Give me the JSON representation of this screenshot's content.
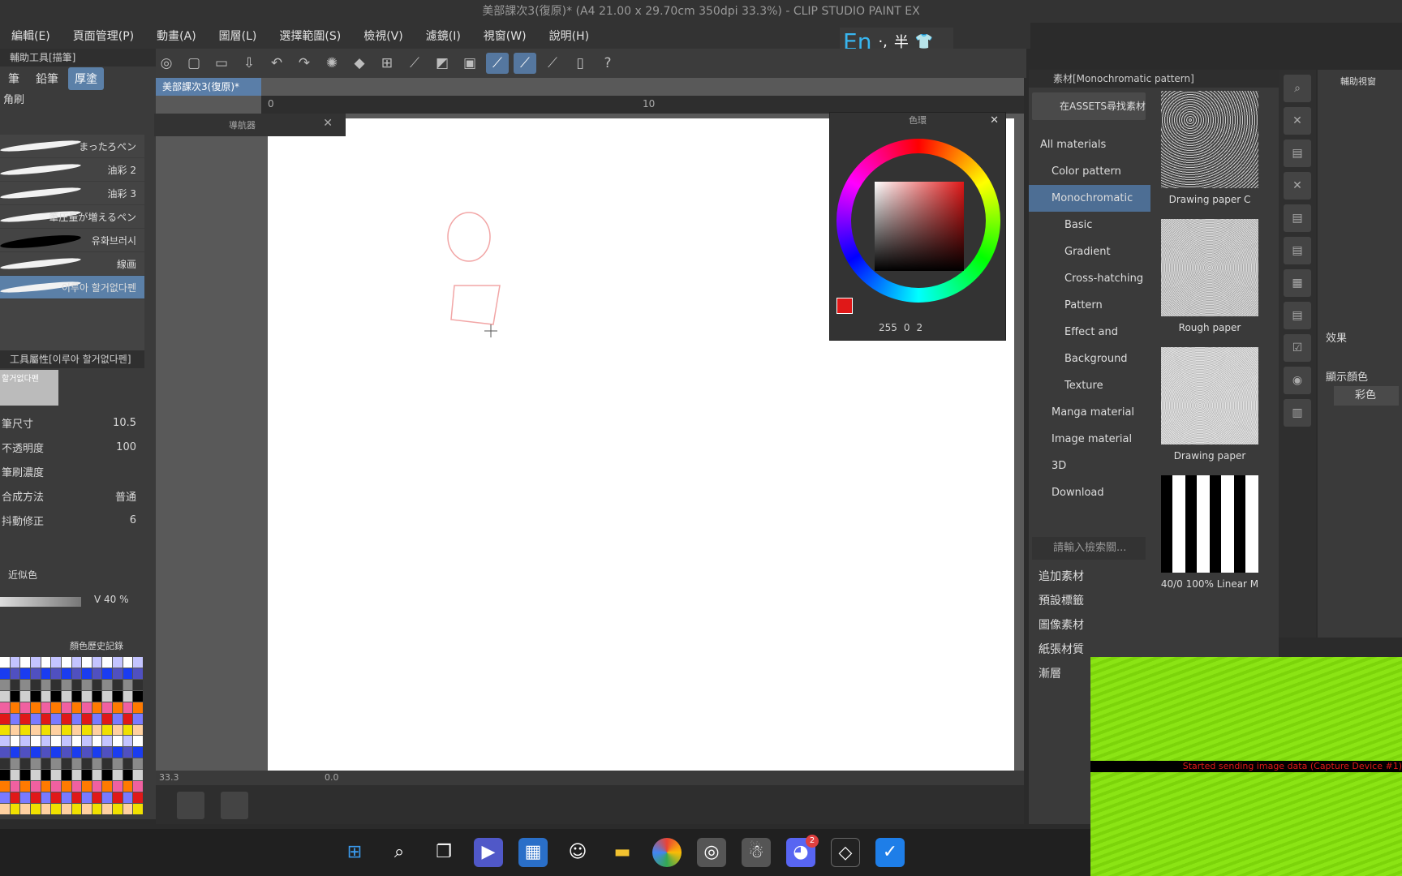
{
  "window": {
    "title": "美部課次3(復原)* (A4 21.00 x 29.70cm 350dpi 33.3%) - CLIP STUDIO PAINT EX"
  },
  "menu": [
    "編輯(E)",
    "頁面管理(P)",
    "動畫(A)",
    "圖層(L)",
    "選擇範圍(S)",
    "檢視(V)",
    "濾鏡(I)",
    "視窗(W)",
    "說明(H)"
  ],
  "ime": {
    "lang": "En",
    "punct": "·,",
    "width": "半",
    "skin_icon": "shirt-icon"
  },
  "doc_tab": {
    "label": "美部課次3(復原)*"
  },
  "ruler": {
    "mark0": "0",
    "mark10": "10"
  },
  "left_panel": {
    "header": "輔助工具[描筆]",
    "subtabs": [
      "筆",
      "鉛筆",
      "厚塗"
    ],
    "category": "角刷",
    "brushes": [
      "まったろペン",
      "油彩 2",
      "油彩 3",
      "筆圧量が増えるペン",
      "유화브러시",
      "線画",
      "이루아 할거없다펜"
    ],
    "tool_prop_header": "工具屬性[이루아 할거없다펜]",
    "preview_label": "할거없다펜",
    "props": [
      {
        "label": "筆尺寸",
        "value": "10.5"
      },
      {
        "label": "不透明度",
        "value": "100"
      },
      {
        "label": "筆刷濃度",
        "value": ""
      },
      {
        "label": "合成方法",
        "value": "普通"
      },
      {
        "label": "抖動修正",
        "value": "6"
      }
    ],
    "color_panel_label": "近似色",
    "value_label": "V 40 %",
    "history_label": "顏色歷史記錄"
  },
  "navigator": {
    "title": "導航器"
  },
  "color_wheel": {
    "title": "色環",
    "r": "255",
    "g": "0",
    "b": "2",
    "color_hex": "#e01818"
  },
  "materials": {
    "header": "素材[Monochromatic pattern]",
    "asset_button": "在ASSETS尋找素材",
    "tree": [
      "All materials",
      "Color pattern",
      "Monochromatic",
      "Basic",
      "Gradient",
      "Cross-hatching",
      "Pattern",
      "Effect and",
      "Background",
      "Texture",
      "Manga material",
      "Image material",
      "3D",
      "Download"
    ],
    "selected": "Monochromatic",
    "search_placeholder": "請輸入檢索關...",
    "side_list": [
      "追加素材",
      "預設標籤",
      "圖像素材",
      "紙張材質",
      "漸層"
    ],
    "thumbs": [
      {
        "label": "Drawing paper C"
      },
      {
        "label": "Rough paper"
      },
      {
        "label": "Drawing paper"
      },
      {
        "label": "40/0 100% Linear M"
      }
    ]
  },
  "right_panel": {
    "title": "輔助視窗",
    "effect_label": "效果",
    "display_color_label": "顯示顏色",
    "color_mode": "彩色"
  },
  "status": {
    "zoom": "33.3",
    "rotation": "0.0"
  },
  "capture_overlay": {
    "text": "Started sending image data (Capture Device #1)"
  },
  "taskbar": {
    "items": [
      "windows-start-icon",
      "search-icon",
      "task-view-icon",
      "meet-icon",
      "store-icon",
      "alien-icon",
      "folder-icon",
      "chrome-icon",
      "clip-studio-icon",
      "qq-icon",
      "discord-icon",
      "nox-icon",
      "app-icon"
    ],
    "discord_badge": "2"
  }
}
